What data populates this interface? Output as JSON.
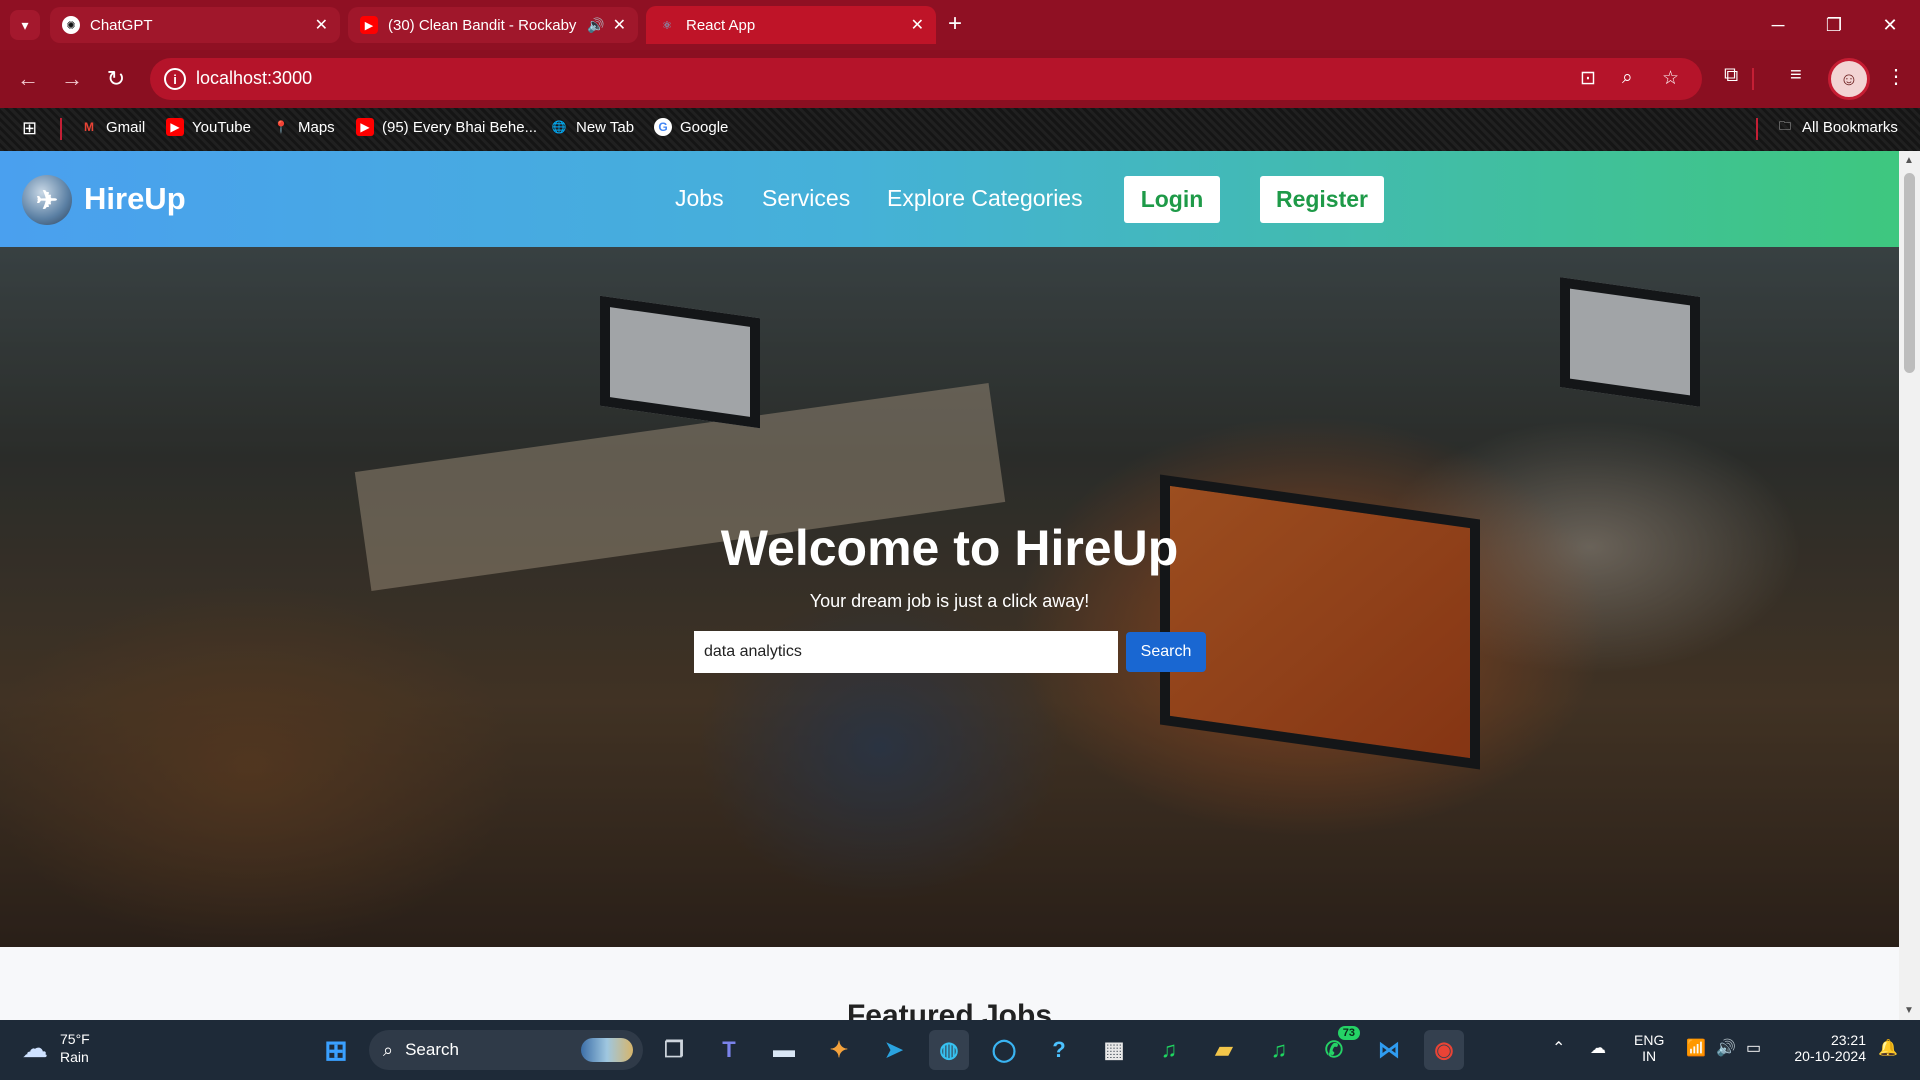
{
  "browser": {
    "tabs": [
      {
        "title": "ChatGPT",
        "icon": "chatgpt-icon"
      },
      {
        "title": "(30) Clean Bandit - Rockaby",
        "icon": "youtube-icon"
      },
      {
        "title": "React App",
        "icon": "react-icon"
      }
    ],
    "url": "localhost:3000",
    "bookmarks": [
      "Gmail",
      "YouTube",
      "Maps",
      "(95) Every Bhai Behe...",
      "New Tab",
      "Google"
    ],
    "all_bookmarks": "All Bookmarks",
    "accent_color": "#8f1023"
  },
  "site": {
    "brand": "HireUp",
    "nav": [
      "Jobs",
      "Services",
      "Explore Categories"
    ],
    "login": "Login",
    "register": "Register",
    "hero_title": "Welcome to HireUp",
    "hero_subtitle": "Your dream job is just a click away!",
    "search_value": "data analytics",
    "search_button": "Search",
    "section_title": "Featured Jobs"
  },
  "taskbar": {
    "temperature": "75°F",
    "condition": "Rain",
    "search": "Search",
    "whatsapp_badge": "73",
    "language": "ENG",
    "region": "IN",
    "time": "23:21",
    "date": "20-10-2024"
  }
}
